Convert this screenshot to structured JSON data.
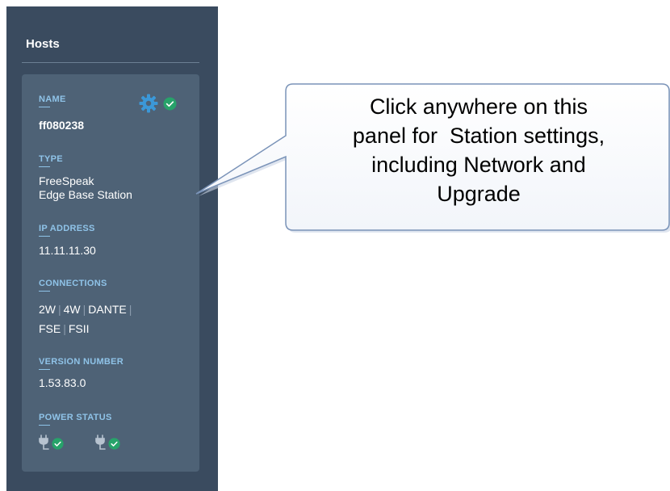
{
  "sidebar": {
    "title": "Hosts"
  },
  "host": {
    "name_label": "NAME",
    "name": "ff080238",
    "type_label": "TYPE",
    "type_line1": "FreeSpeak",
    "type_line2": "Edge Base Station",
    "ip_label": "IP ADDRESS",
    "ip": "11.11.11.30",
    "connections_label": "CONNECTIONS",
    "connections": [
      "2W",
      "4W",
      "DANTE",
      "FSE",
      "FSII"
    ],
    "version_label": "VERSION NUMBER",
    "version": "1.53.83.0",
    "power_label": "POWER STATUS"
  },
  "callout": {
    "lines": [
      "Click anywhere on this",
      "panel for  Station settings,",
      "including Network and",
      "Upgrade"
    ]
  },
  "colors": {
    "sidebar_bg": "#3a4b5f",
    "card_bg": "#4e6276",
    "label": "#8fc3e8",
    "gear": "#3b98d8",
    "status_ok": "#27a36a",
    "callout_border": "#7a93b8"
  },
  "icons": [
    "gear-icon",
    "check-circle-icon",
    "power-plug-icon"
  ]
}
